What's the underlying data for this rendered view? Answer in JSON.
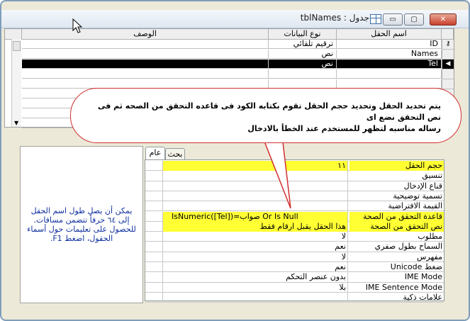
{
  "window": {
    "title": "جدول : tblNames",
    "btn_min": "▭",
    "btn_max": "▢",
    "btn_close": "✕"
  },
  "grid": {
    "headers": {
      "field_name": "اسم الحقل",
      "data_type": "نوع البيانات",
      "description": "الوصف"
    },
    "rows": [
      {
        "field": "ID",
        "type": "ترقيم تلقائي",
        "selected": false,
        "key": true
      },
      {
        "field": "Names",
        "type": "نص",
        "selected": false,
        "key": false
      },
      {
        "field": "Tel",
        "type": "نص",
        "selected": true,
        "key": false
      }
    ]
  },
  "balloon": {
    "line1": "يتم تحديد الحقل وتحديد حجم الحقل تقوم بكتابه الكود فى قاعده التحقق من الصحه ثم فى نص التحقق نضع اى",
    "line2": "رساله مناسبه لتظهر للمستخدم عند الخطأ بالادخال"
  },
  "tabs": {
    "general": "عام",
    "lookup": "بحث"
  },
  "hint": {
    "text": "يمكن أن يصل طول اسم الحقل إلى ٦٤ حرفاً تتضمن مسافات. للحصول على تعليمات حول أسماء الحقول، اضغط F1."
  },
  "properties": [
    {
      "name": "حجم الحقل",
      "value": "١١",
      "highlight": true
    },
    {
      "name": "تنسيق",
      "value": "",
      "highlight": false
    },
    {
      "name": "قناع الإدخال",
      "value": "",
      "highlight": false
    },
    {
      "name": "تسمية توضيحية",
      "value": "",
      "highlight": false
    },
    {
      "name": "القيمة الافتراضية",
      "value": "",
      "highlight": false
    },
    {
      "name": "قاعدة التحقق من الصحة",
      "value": "IsNumeric([Tel])=صواب Or Is Null",
      "highlight": true,
      "ltr": true
    },
    {
      "name": "نص التحقق من الصحة",
      "value": "هذا الحقل يقبل ارقام فقط",
      "highlight": true
    },
    {
      "name": "مطلوب",
      "value": "لا",
      "highlight": false
    },
    {
      "name": "السماح بطول صفري",
      "value": "نعم",
      "highlight": false
    },
    {
      "name": "مفهرس",
      "value": "لا",
      "highlight": false
    },
    {
      "name": "ضغط Unicode",
      "value": "نعم",
      "highlight": false
    },
    {
      "name": "IME Mode",
      "value": "بدون عنصر التحكم",
      "highlight": false
    },
    {
      "name": "IME Sentence Mode",
      "value": "بلا",
      "highlight": false
    },
    {
      "name": "علامات ذكية",
      "value": "",
      "highlight": false
    }
  ]
}
